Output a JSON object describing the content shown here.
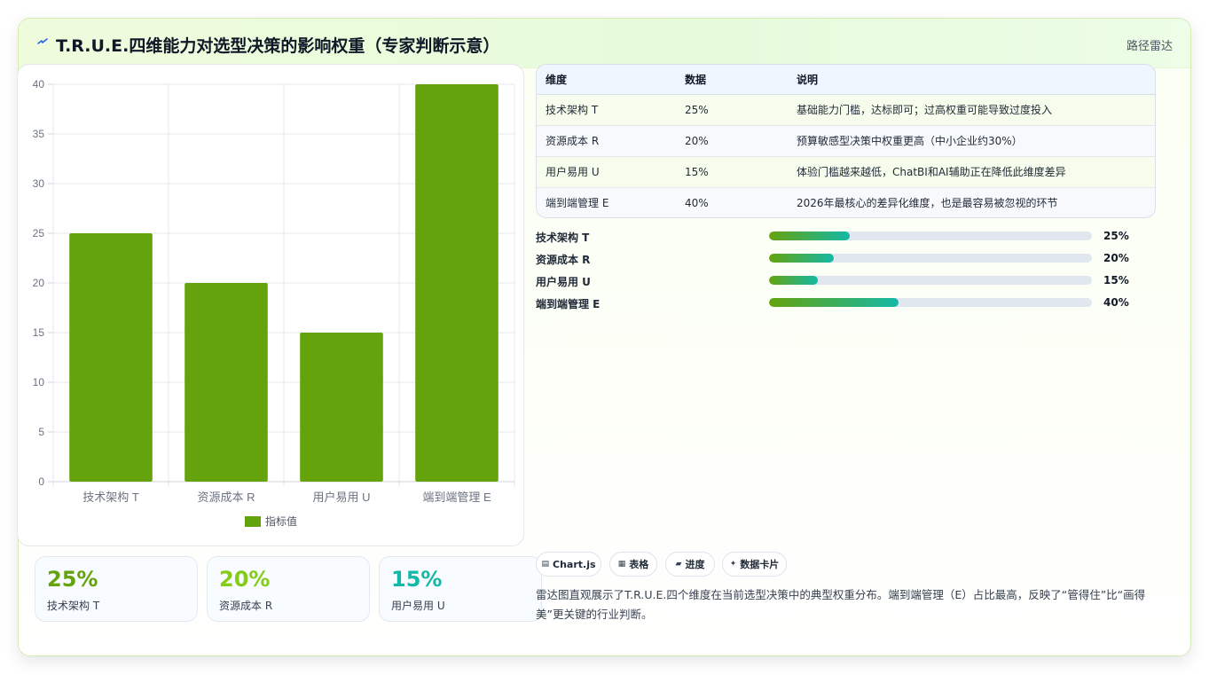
{
  "header": {
    "title": "T.R.U.E.四维能力对选型决策的影响权重（专家判断示意）",
    "tag": "路径雷达",
    "logo_icon": "lightning-icon"
  },
  "chart_data": {
    "type": "bar",
    "categories": [
      "技术架构 T",
      "资源成本 R",
      "用户易用 U",
      "端到端管理 E"
    ],
    "series": [
      {
        "name": "指标值",
        "values": [
          25,
          20,
          15,
          40
        ],
        "color": "#65a30d"
      }
    ],
    "yticks": [
      "0",
      "5",
      "10",
      "15",
      "20",
      "25",
      "30",
      "35",
      "40"
    ],
    "ylim": [
      0,
      40
    ],
    "grid": true,
    "legend": "bottom"
  },
  "stats": [
    {
      "value": "25%",
      "label": "技术架构 T",
      "color": "#65a30d"
    },
    {
      "value": "20%",
      "label": "资源成本 R",
      "color": "#84cc16"
    },
    {
      "value": "15%",
      "label": "用户易用 U",
      "color": "#14b8a6"
    }
  ],
  "table": {
    "headers": [
      "维度",
      "数据",
      "说明"
    ],
    "rows": [
      [
        "技术架构 T",
        "25%",
        "基础能力门槛，达标即可；过高权重可能导致过度投入"
      ],
      [
        "资源成本 R",
        "20%",
        "预算敏感型决策中权重更高（中小企业约30%）"
      ],
      [
        "用户易用 U",
        "15%",
        "体验门槛越来越低，ChatBI和AI辅助正在降低此维度差异"
      ],
      [
        "端到端管理 E",
        "40%",
        "2026年最核心的差异化维度，也是最容易被忽视的环节"
      ]
    ]
  },
  "progress": [
    {
      "label": "技术架构 T",
      "pct_label": "25%",
      "value": 25
    },
    {
      "label": "资源成本 R",
      "pct_label": "20%",
      "value": 20
    },
    {
      "label": "用户易用 U",
      "pct_label": "15%",
      "value": 15
    },
    {
      "label": "端到端管理 E",
      "pct_label": "40%",
      "value": 40
    }
  ],
  "chips": [
    {
      "label": "Chart.js",
      "icon": "chart-icon",
      "glyph": "▤"
    },
    {
      "label": "表格",
      "icon": "table-icon",
      "glyph": "▦"
    },
    {
      "label": "进度",
      "icon": "progress-icon",
      "glyph": "▰"
    },
    {
      "label": "数据卡片",
      "icon": "sparkle-icon",
      "glyph": "✦"
    }
  ],
  "note": "雷达图直观展示了T.R.U.E.四个维度在当前选型决策中的典型权重分布。端到端管理（E）占比最高，反映了“管得住”比“画得美”更关键的行业判断。"
}
